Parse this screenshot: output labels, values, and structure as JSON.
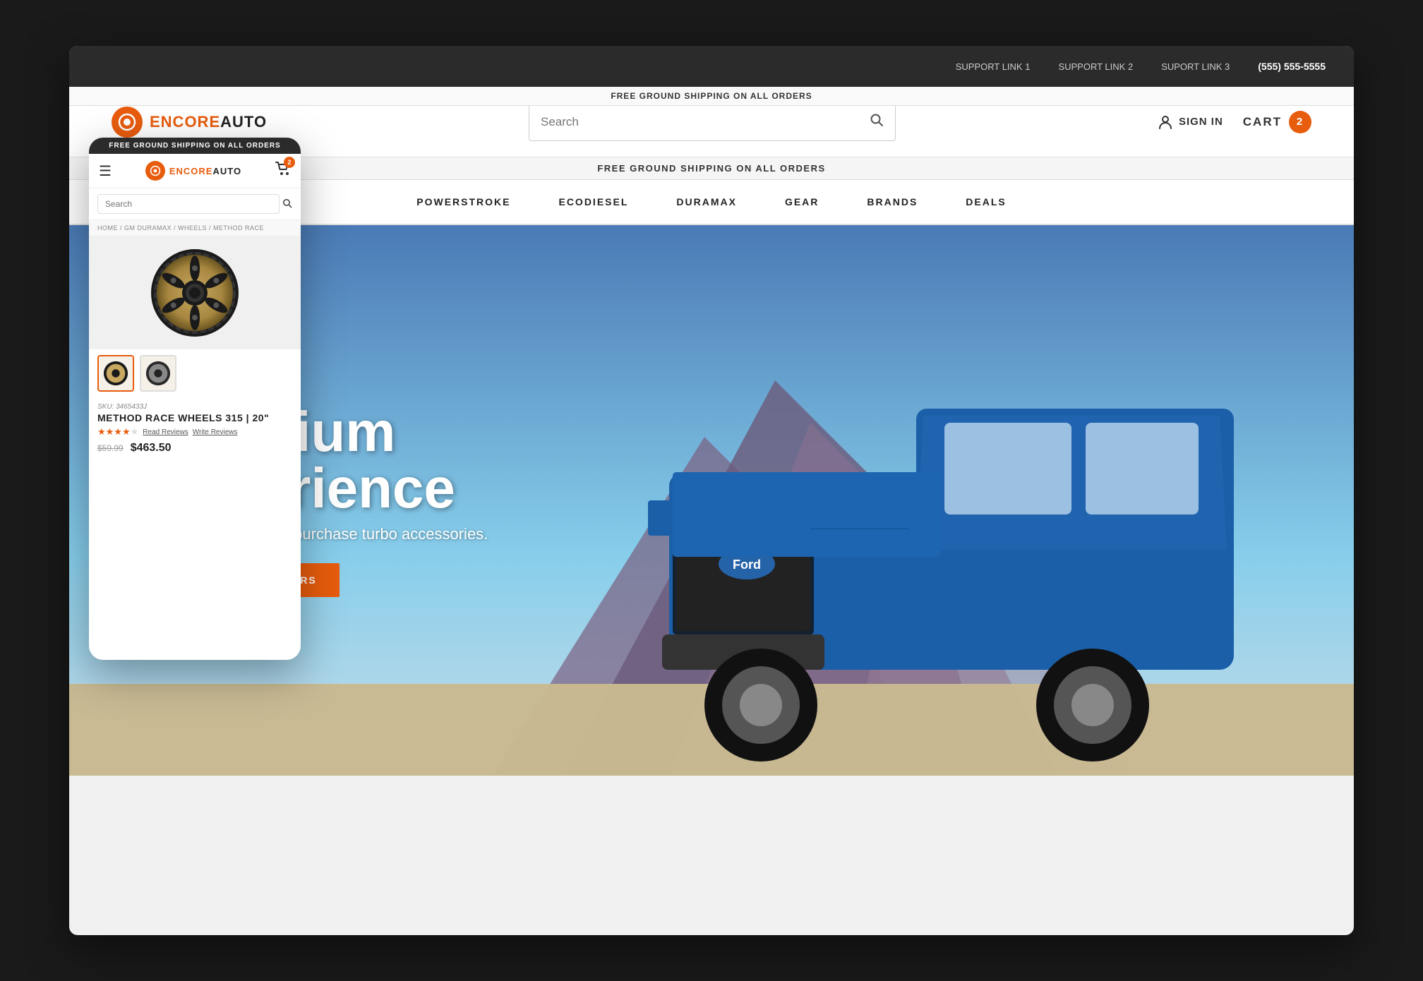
{
  "topbar": {
    "links": [
      "SUPPORT LINK 1",
      "SUPPORT LINK 2",
      "SUPORT LINK 3"
    ],
    "phone": "(555) 555-5555"
  },
  "header": {
    "logo_text_1": "ENCORE",
    "logo_text_2": "AUTO",
    "search_placeholder": "Search",
    "signin_label": "SIGN IN",
    "cart_label": "CART",
    "cart_count": "2"
  },
  "nav": {
    "items": [
      "POWERSTROKE",
      "ECODIESEL",
      "DURAMAX",
      "GEAR",
      "BRANDS",
      "DEALS"
    ]
  },
  "hero": {
    "title_line1": "Premium",
    "title_line2": "Experience",
    "subtitle": "up to $45 when you purchase turbo accessories.",
    "cta_label": "VIEW SPECIAL OFFERS"
  },
  "mobile": {
    "top_bar": "FREE GROUND SHIPPING ON ALL ORDERS",
    "logo_text_1": "ENCORE",
    "logo_text_2": "AUTO",
    "cart_count": "2",
    "search_placeholder": "Search",
    "breadcrumb": "HOME / GM DURAMAX / WHEELS / METHOD RACE",
    "sku": "SKU: 3465433J",
    "product_name": "METHOD RACE WHEELS 315 | 20\"",
    "stars_filled": 4,
    "stars_empty": 1,
    "read_reviews": "Read Reviews",
    "write_reviews": "Write Reviews",
    "price_old": "$59.99",
    "price_new": "$463.50"
  },
  "desktop_top_bar": "FREE GROUND SHIPPING ON ALL ORDERS",
  "colors": {
    "accent": "#e85c0d",
    "dark": "#2b2b2b",
    "nav_text": "#222222"
  }
}
